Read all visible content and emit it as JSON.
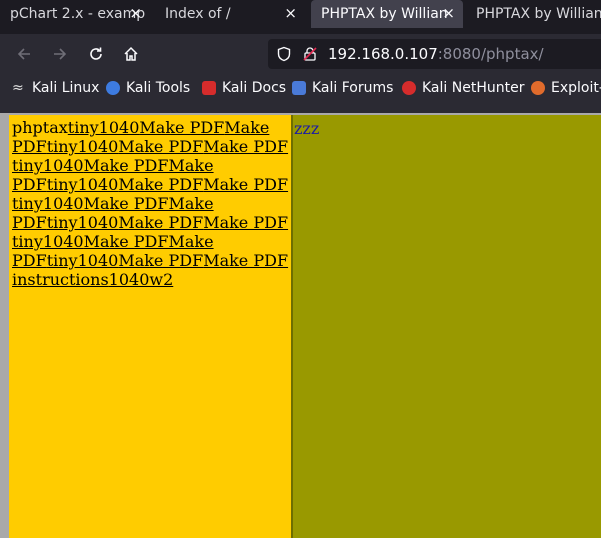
{
  "tabs": [
    {
      "label": "pChart 2.x - examp",
      "close": "×"
    },
    {
      "label": "Index of /",
      "close": "×"
    },
    {
      "label": "PHPTAX by Willian",
      "close": "×"
    },
    {
      "label": "PHPTAX by Willian",
      "close": ""
    }
  ],
  "toolbar": {
    "url_host": "192.168.0.107",
    "url_rest": ":8080/phptax/"
  },
  "bookmarks": [
    {
      "label": "Kali Linux",
      "icon": "kali-linux-icon",
      "color": "#e0e0e0"
    },
    {
      "label": "Kali Tools",
      "icon": "kali-tools-icon",
      "color": "#3d7be0"
    },
    {
      "label": "Kali Docs",
      "icon": "kali-docs-icon",
      "color": "#d62c2c"
    },
    {
      "label": "Kali Forums",
      "icon": "kali-forums-icon",
      "color": "#4a7ad8"
    },
    {
      "label": "Kali NetHunter",
      "icon": "kali-nethunter-icon",
      "color": "#d62c2c"
    },
    {
      "label": "Exploit-",
      "icon": "exploit-db-icon",
      "color": "#e06b2c"
    }
  ],
  "left_frame": {
    "phptax": "phptax",
    "links": [
      "tiny1040",
      "Make PDF",
      "Make PDF",
      "tiny1040",
      "Make PDF",
      "Make PDF",
      "tiny1040",
      "Make PDF",
      "Make PDF",
      "tiny1040",
      "Make PDF",
      "Make PDF",
      "tiny1040",
      "Make PDF",
      "Make PDF",
      "tiny1040",
      "Make PDF",
      "Make PDF",
      "tiny1040",
      "Make PDF",
      "Make PDF",
      "tiny1040",
      "Make PDF",
      "Make PDF"
    ],
    "instructions": "instructions",
    "last": "1040w2"
  },
  "right_frame": {
    "text": "zzz"
  }
}
